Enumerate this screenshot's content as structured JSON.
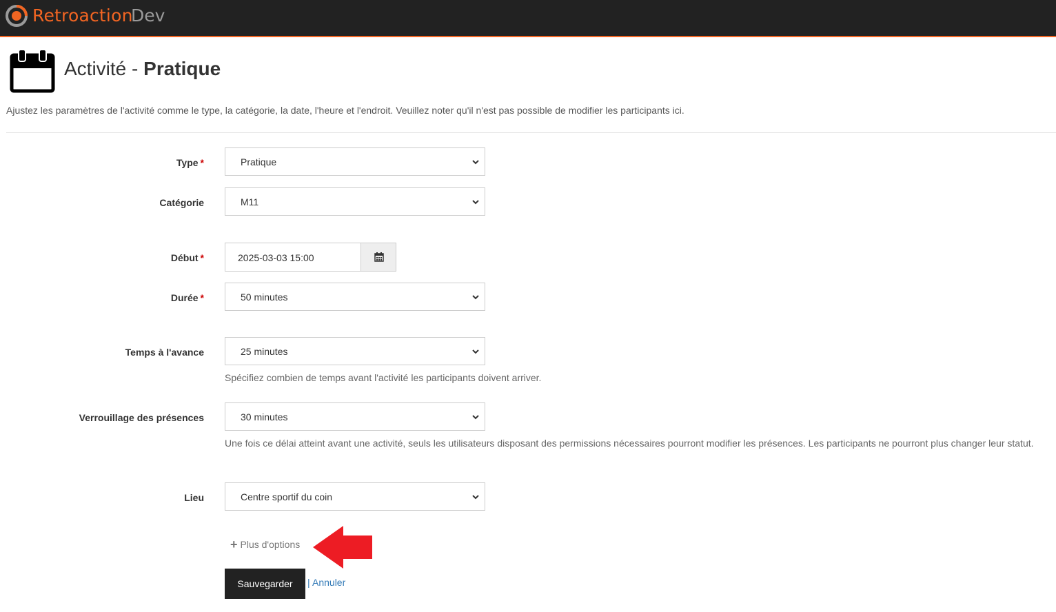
{
  "header": {
    "brand": "Retroaction",
    "env": "Dev",
    "brand_color": "#f26522",
    "logo_icon": "retroaction-logo-icon"
  },
  "page": {
    "icon": "calendar-icon",
    "title_prefix": "Activité - ",
    "title_type": "Pratique",
    "description": "Ajustez les paramètres de l'activité comme le type, la catégorie, la date, l'heure et l'endroit. Veuillez noter qu'il n'est pas possible de modifier les participants ici."
  },
  "form": {
    "type": {
      "label": "Type",
      "required_mark": "*",
      "value": "Pratique"
    },
    "category": {
      "label": "Catégorie",
      "value": "M11"
    },
    "start": {
      "label": "Début",
      "required_mark": "*",
      "value": "2025-03-03 15:00",
      "button_icon": "calendar-icon"
    },
    "duration": {
      "label": "Durée",
      "required_mark": "*",
      "value": "50 minutes"
    },
    "advance": {
      "label": "Temps à l'avance",
      "value": "25 minutes",
      "help": "Spécifiez combien de temps avant l'activité les participants doivent arriver."
    },
    "lock": {
      "label": "Verrouillage des présences",
      "value": "30 minutes",
      "help": "Une fois ce délai atteint avant une activité, seuls les utilisateurs disposant des permissions nécessaires pourront modifier les présences. Les participants ne pourront plus changer leur statut."
    },
    "location": {
      "label": "Lieu",
      "value": "Centre sportif du coin"
    },
    "more_options": "Plus d'options",
    "save": "Sauvegarder",
    "separator": "|",
    "cancel": "Annuler"
  },
  "annotation": {
    "arrow_color": "#ed1c24"
  }
}
